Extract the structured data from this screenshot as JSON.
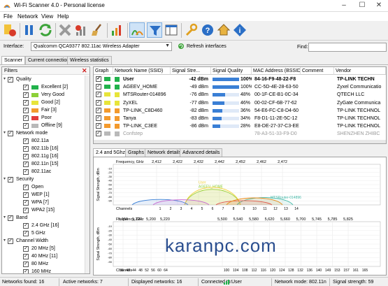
{
  "window": {
    "title": "Wi-Fi Scanner 4.0 - Personal license"
  },
  "menu": [
    "File",
    "Network",
    "View",
    "Help"
  ],
  "interface_row": {
    "label": "Interface:",
    "value": "Qualcomm QCA9377 802.11ac Wireless Adapter",
    "refresh_label": "Refresh interfaces",
    "find_label": "Find:"
  },
  "main_tabs": [
    "Scanner",
    "Current connection",
    "Wireless statistics"
  ],
  "filters": {
    "title": "Filters",
    "groups": [
      {
        "label": "Quality",
        "items": [
          {
            "label": "Excellent [2]",
            "color": "#21b24b"
          },
          {
            "label": "Very Good",
            "color": "#8cd038"
          },
          {
            "label": "Good [2]",
            "color": "#e7e43a"
          },
          {
            "label": "Fair [3]",
            "color": "#f39a2d"
          },
          {
            "label": "Poor",
            "color": "#e23c3c"
          },
          {
            "label": "Offline [9]",
            "color": "#b9b9b9"
          }
        ]
      },
      {
        "label": "Network mode",
        "items": [
          {
            "label": "802.11a"
          },
          {
            "label": "802.11b [16]"
          },
          {
            "label": "802.11g [16]"
          },
          {
            "label": "802.11n [15]"
          },
          {
            "label": "802.11ac"
          }
        ]
      },
      {
        "label": "Security",
        "items": [
          {
            "label": "Open"
          },
          {
            "label": "WEP [1]"
          },
          {
            "label": "WPA [7]"
          },
          {
            "label": "WPA2 [15]"
          }
        ]
      },
      {
        "label": "Band",
        "items": [
          {
            "label": "2.4 GHz [16]"
          },
          {
            "label": "5 GHz"
          }
        ]
      },
      {
        "label": "Channel Width",
        "items": [
          {
            "label": "20 MHz [5]"
          },
          {
            "label": "40 MHz [11]"
          },
          {
            "label": "80 MHz"
          },
          {
            "label": "160 MHz"
          }
        ]
      }
    ]
  },
  "table": {
    "columns": [
      "Graph",
      "Network Name (SSID)",
      "Signal Stre...",
      "Signal Quality",
      "MAC Address (BSSID)",
      "Comment",
      "Vendor"
    ],
    "rows": [
      {
        "ssid": "User",
        "signal": "-42 dBm",
        "quality": 100,
        "quality_label": "100%",
        "mac": "84-16-F9-48-22-F8",
        "vendor": "TP-LINK TECHN",
        "color": "#21b24b",
        "bold": true
      },
      {
        "ssid": "AGEEV_HOME",
        "signal": "-49 dBm",
        "quality": 100,
        "quality_label": "100%",
        "mac": "CC-5D-4E-28-63-50",
        "vendor": "Zyxel Communicatio",
        "color": "#21b24b"
      },
      {
        "ssid": "MTSRouter-014896",
        "signal": "-76 dBm",
        "quality": 48,
        "quality_label": "48%",
        "mac": "00-1F-CE-B1-0C-34",
        "vendor": "QTECH LLC",
        "color": "#e7e43a"
      },
      {
        "ssid": "ZyXEL",
        "signal": "-77 dBm",
        "quality": 46,
        "quality_label": "46%",
        "mac": "00-02-CF-6B-77-62",
        "vendor": "ZyGate Communica",
        "color": "#e7e43a"
      },
      {
        "ssid": "TP-LINK_C8D460",
        "signal": "-82 dBm",
        "quality": 36,
        "quality_label": "36%",
        "mac": "54-E6-FC-C8-D4-60",
        "vendor": "TP-LINK TECHNOL",
        "color": "#f39a2d"
      },
      {
        "ssid": "Tanya",
        "signal": "-83 dBm",
        "quality": 34,
        "quality_label": "34%",
        "mac": "F8-D1-11-2E-5C-12",
        "vendor": "TP-LINK TECHNOL",
        "color": "#f39a2d"
      },
      {
        "ssid": "TP-LINK_C3EE",
        "signal": "-86 dBm",
        "quality": 28,
        "quality_label": "28%",
        "mac": "E8-DE-27-37-C3-EE",
        "vendor": "TP-LINK TECHNOL",
        "color": "#f39a2d"
      },
      {
        "ssid": "Confstep",
        "signal": "",
        "quality": 0,
        "quality_label": "",
        "mac": "78-A3-51-33-F9-D0",
        "vendor": "SHENZHEN ZHIBC",
        "color": "#b9b9b9"
      }
    ]
  },
  "graph_tabs": [
    "2.4 and 5Ghz",
    "Graphs",
    "Network details",
    "Advanced details"
  ],
  "graph24": {
    "freq_label": "Frequency, GHz",
    "freq_ticks": [
      "2,412",
      "2,422",
      "2,432",
      "2,442",
      "2,452",
      "2,462",
      "2,472"
    ],
    "ylabel": "Signal Strength, dBm",
    "y_ticks": [
      "-10",
      "-20",
      "-30",
      "-40",
      "-50",
      "-60",
      "-70",
      "-80",
      "-90"
    ],
    "channels_label": "Channels",
    "channel_ticks": [
      "1",
      "2",
      "3",
      "4",
      "5",
      "6",
      "7",
      "8",
      "9",
      "10",
      "11",
      "12",
      "13",
      "14"
    ],
    "network_labels": [
      "AGEEV_HOME",
      "User",
      "MTSRouter-014896"
    ]
  },
  "graph5": {
    "freq_label": "Frequency, GHz",
    "freq_ticks": [
      "5,150",
      "5,220",
      "5,200",
      "5,220",
      "5,500",
      "5,540",
      "5,580",
      "5,620",
      "5,660",
      "5,700",
      "5,745",
      "5,785",
      "5,825"
    ],
    "ylabel": "Signal Strength, dBm",
    "y_ticks": [
      "-10",
      "-20",
      "-30",
      "-40",
      "-50",
      "-60",
      "-70",
      "-80",
      "-90"
    ],
    "channels_label": "Channels",
    "channel_ticks": [
      "36",
      "40",
      "44",
      "48",
      "52",
      "56",
      "60",
      "64",
      "100",
      "104",
      "108",
      "112",
      "116",
      "120",
      "124",
      "128",
      "132",
      "136",
      "140",
      "149",
      "153",
      "157",
      "161",
      "165"
    ]
  },
  "watermark": "karanpc.com",
  "status": {
    "found": "Networks found: 16",
    "active": "Active networks: 7",
    "displayed": "Displayed networks: 16",
    "connected_label": "Connected to:",
    "connected_value": "User",
    "mode": "Network mode: 802.11n",
    "strength": "Signal strength: 59"
  }
}
